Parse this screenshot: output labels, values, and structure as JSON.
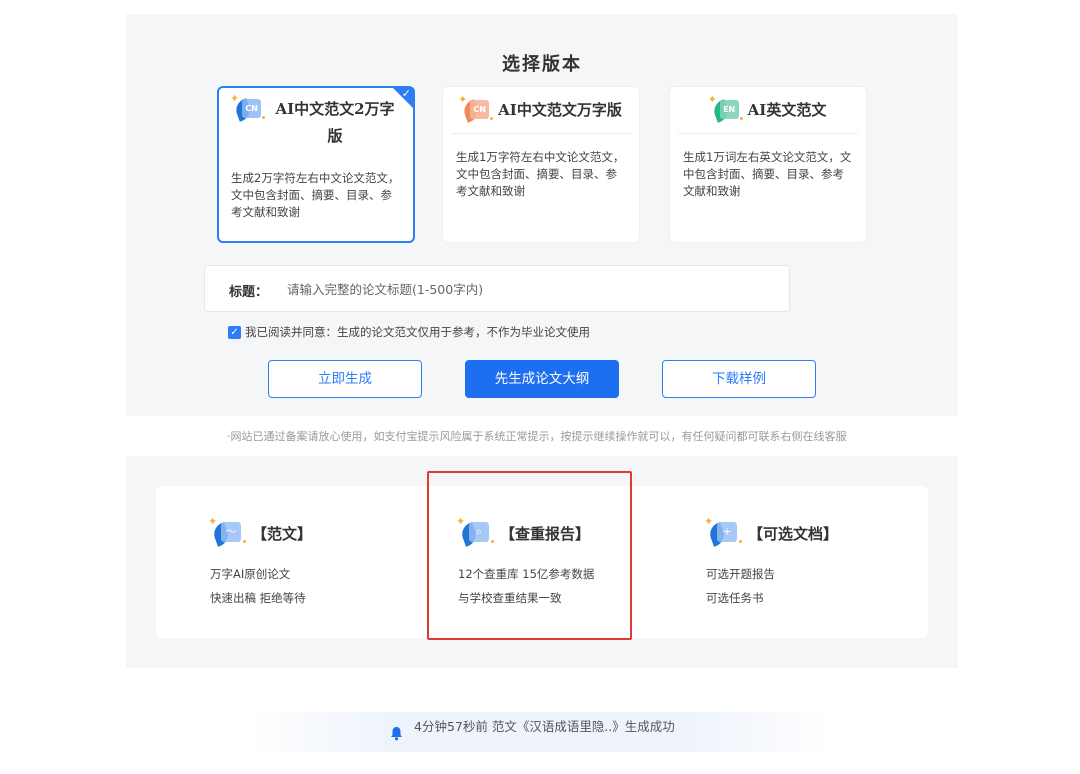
{
  "section_title": "选择版本",
  "versions": [
    {
      "name": "AI中文范文2万字版",
      "icon": "CN",
      "selected": true,
      "desc": "生成2万字符左右中文论文范文，文中包含封面、摘要、目录、参考文献和致谢"
    },
    {
      "name": "AI中文范文万字版",
      "icon": "CN",
      "selected": false,
      "desc": "生成1万字符左右中文论文范文，文中包含封面、摘要、目录、参考文献和致谢"
    },
    {
      "name": "AI英文范文",
      "icon": "EN",
      "selected": false,
      "desc": "生成1万词左右英文论文范文，文中包含封面、摘要、目录、参考文献和致谢"
    }
  ],
  "title_field": {
    "label": "标题：",
    "placeholder": "请输入完整的论文标题(1-500字内)",
    "value": ""
  },
  "agreement": {
    "checked": true,
    "text": "我已阅读并同意：生成的论文范文仅用于参考，不作为毕业论文使用"
  },
  "buttons": {
    "generate_now": "立即生成",
    "outline_first": "先生成论文大纲",
    "download_sample": "下载样例"
  },
  "notice": "·网站已通过备案请放心使用，如支付宝提示风险属于系统正常提示，按提示继续操作就可以，有任何疑问都可联系右侧在线客服",
  "features": [
    {
      "title": "【范文】",
      "icon": "chart-doc-icon",
      "lines": [
        "万字AI原创论文",
        "快速出稿 拒绝等待"
      ]
    },
    {
      "title": "【查重报告】",
      "icon": "search-doc-icon",
      "lines": [
        "12个查重库 15亿参考数据",
        "与学校查重结果一致"
      ]
    },
    {
      "title": "【可选文档】",
      "icon": "plus-doc-icon",
      "lines": [
        "可选开题报告",
        "可选任务书"
      ]
    }
  ],
  "ticker": {
    "icon": "bell-icon",
    "text": "4分钟57秒前 范文《汉语成语里隐..》生成成功"
  },
  "colors": {
    "accent": "#1e6ff0",
    "highlight": "#e23a32",
    "panel_bg": "#f5f6f8"
  }
}
